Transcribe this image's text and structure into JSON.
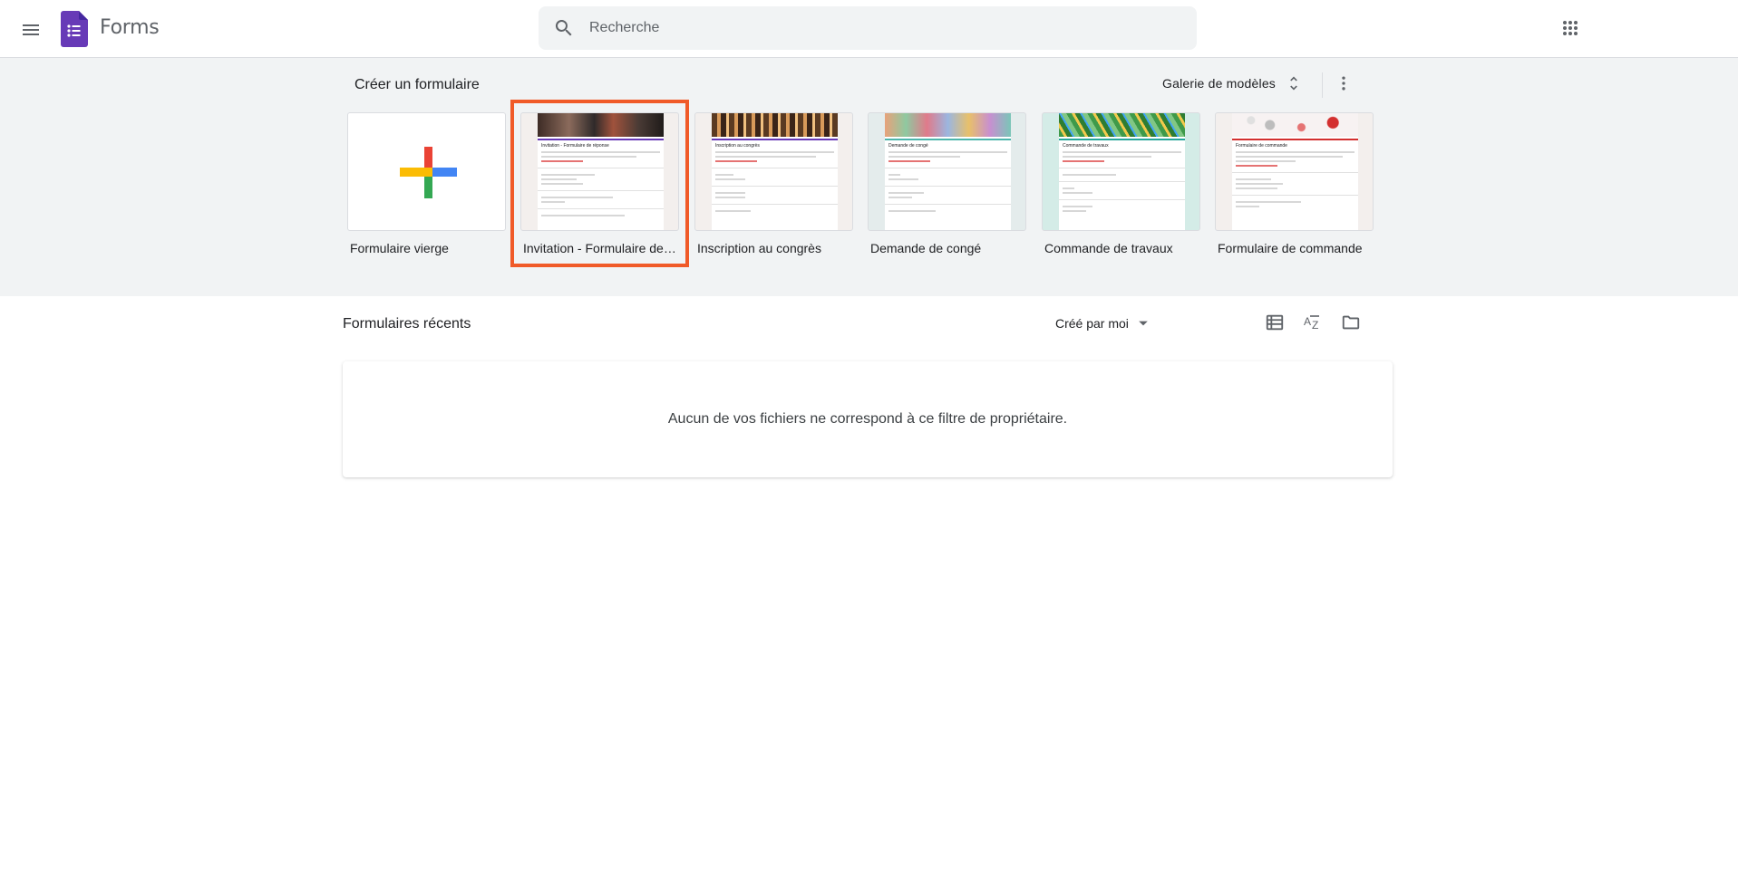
{
  "header": {
    "app_name": "Forms",
    "search_placeholder": "Recherche",
    "menu_icon": "hamburger-menu-icon",
    "apps_icon": "google-apps-grid-icon"
  },
  "templates": {
    "title": "Créer un formulaire",
    "gallery_label": "Galerie de modèles",
    "items": [
      {
        "label": "Formulaire vierge",
        "selected": false
      },
      {
        "label": "Invitation - Formulaire de réponse",
        "selected": true,
        "preview_title": "Invitation - Formulaire de réponse"
      },
      {
        "label": "Inscription au congrès",
        "selected": false,
        "preview_title": "Inscription au congrès"
      },
      {
        "label": "Demande de congé",
        "selected": false,
        "preview_title": "Demande de congé"
      },
      {
        "label": "Commande de travaux",
        "selected": false,
        "preview_title": "Commande de travaux"
      },
      {
        "label": "Formulaire de commande",
        "selected": false,
        "preview_title": "Formulaire de commande"
      }
    ]
  },
  "recent": {
    "title": "Formulaires récents",
    "owner_filter": "Créé par moi",
    "empty_message": "Aucun de vos fichiers ne correspond à ce filtre de propriétaire."
  },
  "colors": {
    "brand_purple": "#673ab7",
    "selection_outline": "#f05a28",
    "template_band_bg": "#f1f3f4"
  }
}
